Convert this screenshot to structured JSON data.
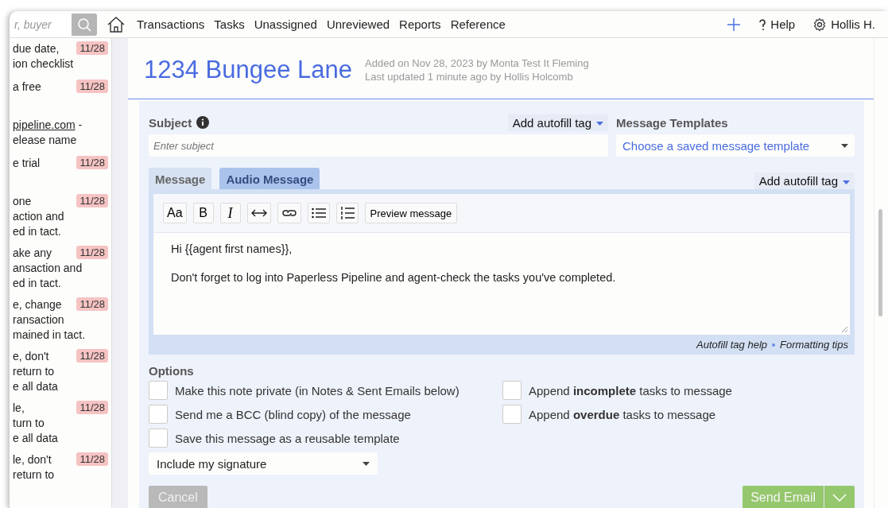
{
  "nav": {
    "search": {
      "placeholder": "r, buyer"
    },
    "links": [
      {
        "label": "Transactions",
        "selected": false
      },
      {
        "label": "Tasks",
        "selected": false
      },
      {
        "label": "Unassigned",
        "selected": false
      },
      {
        "label": "Unreviewed",
        "selected": false
      },
      {
        "label": "Reports",
        "selected": false
      },
      {
        "label": "Reference",
        "selected": false
      }
    ],
    "help": "Help",
    "user": "Hollis H."
  },
  "sidebar": {
    "items": [
      {
        "lines": [
          "due date,",
          "ion checklist"
        ],
        "badge": "11/28"
      },
      {
        "lines": [
          "a free"
        ],
        "badge": "11/28"
      },
      {
        "link": "pipeline.com",
        "lines": [
          " -",
          "elease name"
        ]
      },
      {
        "lines": [
          "e trial"
        ],
        "badge": "11/28"
      },
      {
        "lines": [
          "one",
          "action and",
          "ed in tact."
        ],
        "badge": "11/28"
      },
      {
        "lines": [
          "ake any",
          "ansaction and",
          "ed in tact."
        ],
        "badge": "11/28"
      },
      {
        "lines": [
          "e, change",
          "ransaction",
          "mained in tact."
        ],
        "badge": "11/28"
      },
      {
        "lines": [
          "e, don't",
          "return to",
          "e all data"
        ],
        "badge": "11/28"
      },
      {
        "lines": [
          "le,",
          "turn to",
          "e all data"
        ],
        "badge": "11/28"
      },
      {
        "lines": [
          "le, don't",
          "return to"
        ],
        "badge": "11/28"
      }
    ]
  },
  "header": {
    "title": "1234 Bungee Lane",
    "added": "Added on Nov 28, 2023 by Monta Test It Fleming",
    "updated": "Last updated 1 minute ago by Hollis Holcomb"
  },
  "form": {
    "subject_label": "Subject",
    "autofill": "Add autofill tag",
    "subject": {
      "placeholder": "Enter subject"
    },
    "templates_label": "Message Templates",
    "template_select": "Choose a saved message template",
    "tabs": [
      {
        "label": "Message",
        "selected": false
      },
      {
        "label": "Audio Message",
        "selected": true
      }
    ],
    "autofill2": "Add autofill tag",
    "toolbar": [
      {
        "kind": "text",
        "label": "Aa"
      },
      {
        "kind": "text",
        "label": "B"
      },
      {
        "kind": "text",
        "label": "I"
      },
      {
        "kind": "arrows"
      },
      {
        "kind": "link"
      },
      {
        "kind": "bullets"
      },
      {
        "kind": "numbers"
      },
      {
        "kind": "text",
        "label": "Preview message"
      }
    ],
    "body": [
      "Hi {{agent first names}},",
      "Don't forget to log into Paperless Pipeline and agent-check the tasks you've completed."
    ],
    "help_links": [
      "Autofill tag help",
      "Formatting tips"
    ],
    "options_label": "Options",
    "options": [
      {
        "label": "Make this note private (in Notes & Sent Emails below)",
        "checked": false
      },
      {
        "label": "Append **incomplete** tasks to message",
        "checked": false
      },
      {
        "label": "Send me a BCC (blind copy) of the message",
        "checked": false
      },
      {
        "label": "Append **overdue** tasks to message",
        "checked": false
      },
      {
        "label": "Save this message as a reusable template",
        "checked": false
      }
    ],
    "signature": "Include my signature",
    "cancel": "Cancel",
    "send": "Send Email"
  }
}
